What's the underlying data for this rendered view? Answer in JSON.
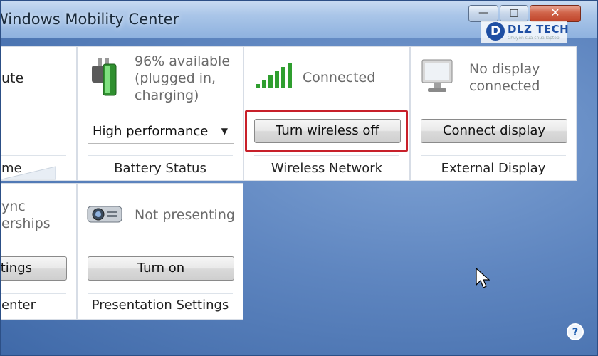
{
  "window": {
    "title": "Windows Mobility Center",
    "controls": {
      "minimize": "—",
      "maximize": "□",
      "close": "✕"
    }
  },
  "watermark": {
    "mark": "D",
    "name": "DLZ TECH",
    "tagline": "Chuyên sửa chữa laptop"
  },
  "tiles": {
    "volume": {
      "status": "ute",
      "title": "me"
    },
    "battery": {
      "status_lines": [
        "96% available",
        "(plugged in,",
        "charging)"
      ],
      "plan": "High performance",
      "title": "Battery Status"
    },
    "wireless": {
      "status": "Connected",
      "button": "Turn wireless off",
      "title": "Wireless Network"
    },
    "display": {
      "status_lines": [
        "No display",
        "connected"
      ],
      "button": "Connect display",
      "title": "External Display"
    },
    "sync": {
      "status_lines": [
        "ync",
        "erships"
      ],
      "button": "ttings",
      "title": "enter"
    },
    "presentation": {
      "status": "Not presenting",
      "button": "Turn on",
      "title": "Presentation Settings"
    }
  },
  "help": {
    "label": "?"
  },
  "colors": {
    "highlight": "#c8202a",
    "desktop": "#5f86c0",
    "titlebar": "#a9c5e8"
  }
}
